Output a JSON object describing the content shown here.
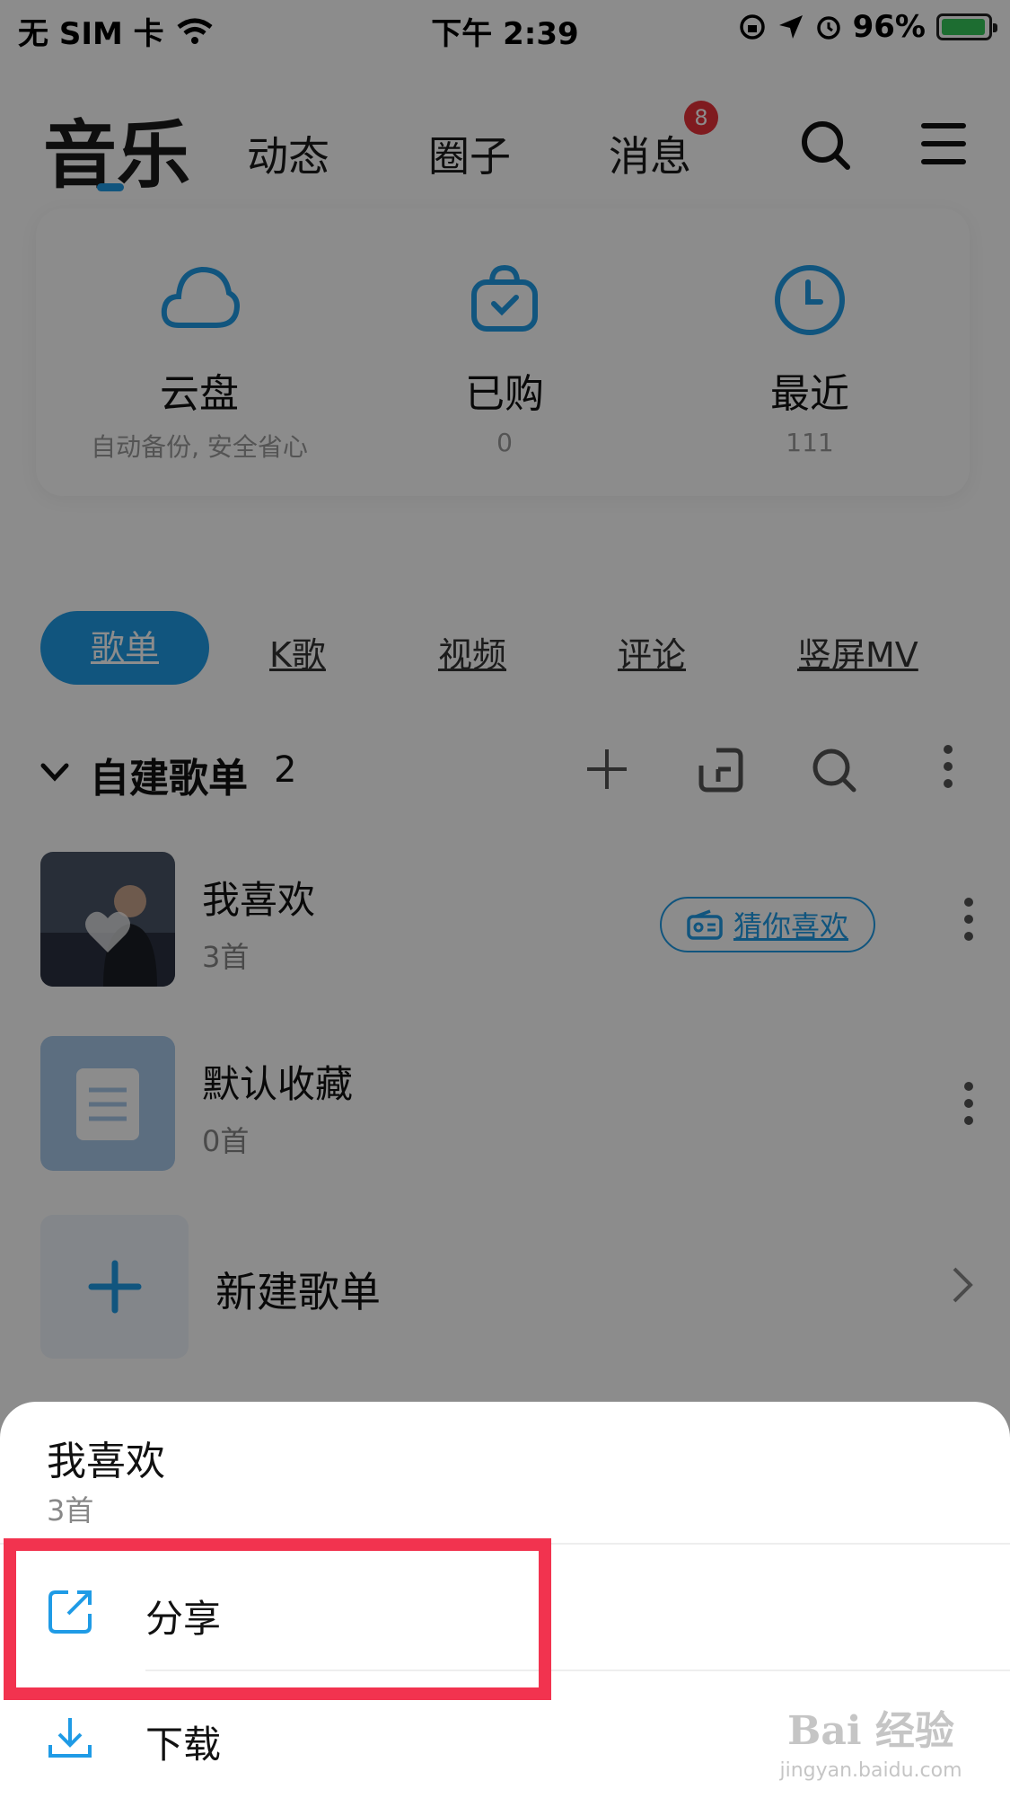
{
  "status_bar": {
    "carrier": "无 SIM 卡",
    "time": "下午 2:39",
    "battery": "96%",
    "battery_level": 0.96
  },
  "top_nav": {
    "tabs": [
      "音乐",
      "动态",
      "圈子",
      "消息"
    ],
    "active_tab": "音乐",
    "message_badge": "8",
    "icons": [
      "search-icon",
      "menu-icon"
    ]
  },
  "quick_access": [
    {
      "title": "云盘",
      "sub": "自动备份, 安全省心",
      "icon": "cloud-icon"
    },
    {
      "title": "已购",
      "sub": "0",
      "icon": "purchased-bag-icon"
    },
    {
      "title": "最近",
      "sub": "111",
      "icon": "clock-icon"
    }
  ],
  "sub_tabs": [
    "歌单",
    "K歌",
    "视频",
    "评论",
    "竖屏MV"
  ],
  "section": {
    "title": "自建歌单",
    "count": "2",
    "icons": [
      "add-icon",
      "import-icon",
      "search-icon",
      "more-icon"
    ]
  },
  "playlists": [
    {
      "name": "我喜欢",
      "count": "3首",
      "action": "猜你喜欢"
    },
    {
      "name": "默认收藏",
      "count": "0首"
    }
  ],
  "new_playlist_label": "新建歌单",
  "sheet": {
    "title": "我喜欢",
    "subtitle": "3首",
    "items": [
      {
        "label": "分享",
        "icon": "share-icon"
      },
      {
        "label": "下载",
        "icon": "download-icon"
      }
    ]
  },
  "watermark": {
    "main": "Bai 经验",
    "url": "jingyan.baidu.com"
  },
  "colors": {
    "accent": "#1f9be6",
    "badge": "#e8323a",
    "highlight": "#f2334f"
  }
}
